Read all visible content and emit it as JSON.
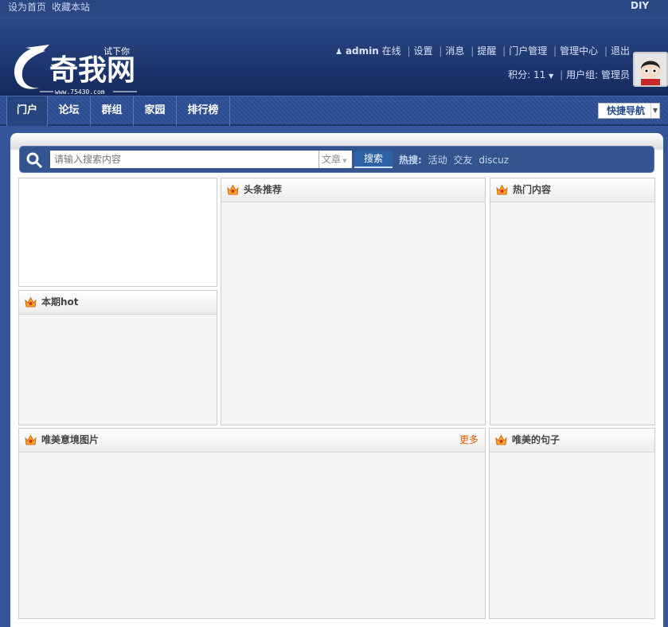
{
  "topbar": {
    "set_home": "设为首页",
    "bookmark": "收藏本站",
    "diy": "DIY"
  },
  "logo": {
    "text": "奇我网",
    "sub": "www.75430.com",
    "tag": "试下你"
  },
  "user": {
    "name": "admin",
    "status": "在线",
    "links": [
      "设置",
      "消息",
      "提醒",
      "门户管理",
      "管理中心",
      "退出"
    ],
    "credits_label": "积分: 11",
    "group": "用户组: 管理员"
  },
  "nav": {
    "items": [
      "门户",
      "论坛",
      "群组",
      "家园",
      "排行榜"
    ],
    "quick_nav": "快捷导航"
  },
  "search": {
    "placeholder": "请输入搜索内容",
    "type": "文章",
    "button": "搜索",
    "hot_label": "热搜:",
    "hot": [
      "活动",
      "交友",
      "discuz"
    ]
  },
  "blocks": {
    "headline": "头条推荐",
    "popular": "热门内容",
    "hot_issue": "本期hot",
    "pictures": "唯美意境图片",
    "more": "更多",
    "sentences": "唯美的句子"
  }
}
